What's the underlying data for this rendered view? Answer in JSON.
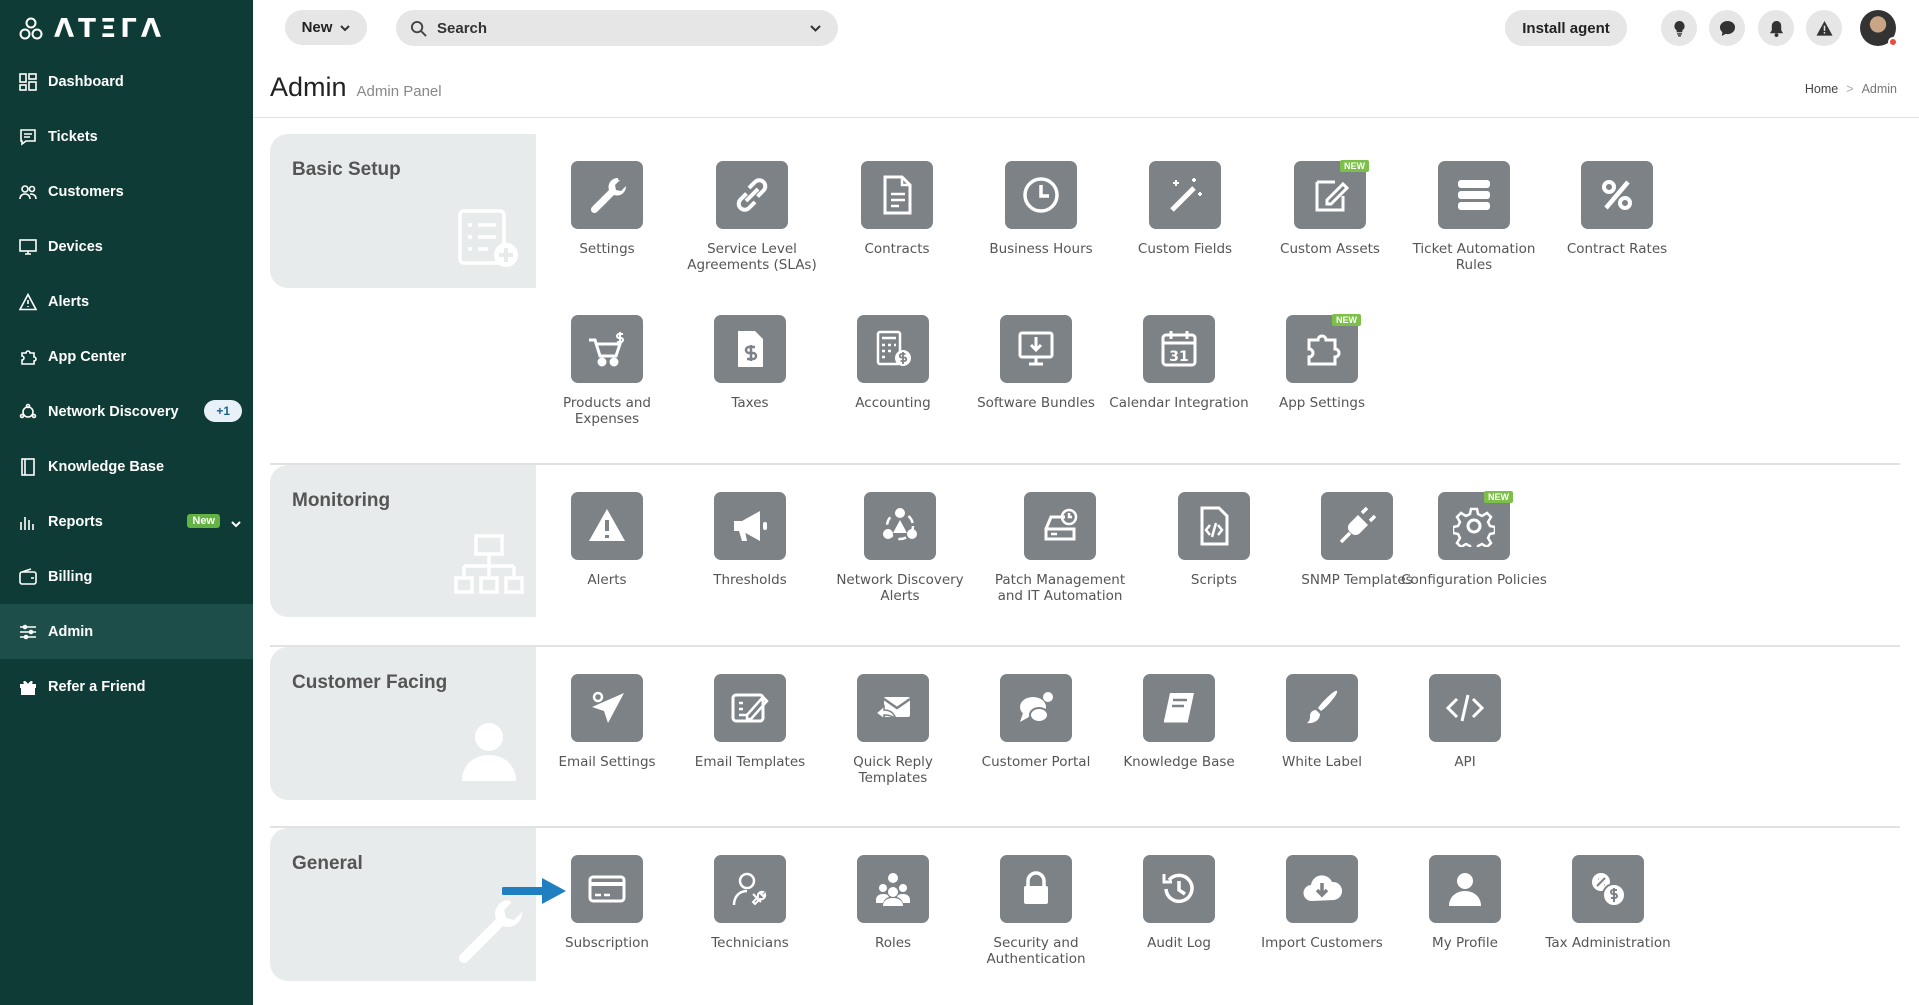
{
  "app": {
    "logo_text": "ΛTΞΓΛ"
  },
  "sidebar": {
    "items": [
      {
        "label": "Dashboard",
        "icon": "grid-icon"
      },
      {
        "label": "Tickets",
        "icon": "ticket-icon"
      },
      {
        "label": "Customers",
        "icon": "users-icon"
      },
      {
        "label": "Devices",
        "icon": "monitor-icon"
      },
      {
        "label": "Alerts",
        "icon": "warning-icon"
      },
      {
        "label": "App Center",
        "icon": "puzzle-icon"
      },
      {
        "label": "Network Discovery",
        "icon": "network-icon",
        "badge": "+1"
      },
      {
        "label": "Knowledge Base",
        "icon": "book-icon"
      },
      {
        "label": "Reports",
        "icon": "chart-icon",
        "badge": "New"
      },
      {
        "label": "Billing",
        "icon": "wallet-icon"
      },
      {
        "label": "Admin",
        "icon": "sliders-icon",
        "active": true
      },
      {
        "label": "Refer a Friend",
        "icon": "gift-icon"
      }
    ]
  },
  "topbar": {
    "new_label": "New",
    "search_placeholder": "Search",
    "install_agent_label": "Install agent"
  },
  "page": {
    "title": "Admin",
    "subtitle": "Admin Panel",
    "breadcrumb": [
      "Home",
      "Admin"
    ]
  },
  "sections": {
    "basic_setup": {
      "title": "Basic Setup",
      "items": [
        "Settings",
        "Service Level Agreements (SLAs)",
        "Contracts",
        "Business Hours",
        "Custom Fields",
        "Custom Assets",
        "Ticket Automation Rules",
        "Contract Rates",
        "Products and Expenses",
        "Taxes",
        "Accounting",
        "Software Bundles",
        "Calendar Integration",
        "App Settings"
      ]
    },
    "monitoring": {
      "title": "Monitoring",
      "items": [
        "Alerts",
        "Thresholds",
        "Network Discovery Alerts",
        "Patch Management and IT Automation",
        "Scripts",
        "SNMP Templates",
        "Configuration Policies"
      ]
    },
    "customer_facing": {
      "title": "Customer Facing",
      "items": [
        "Email Settings",
        "Email Templates",
        "Quick Reply Templates",
        "Customer Portal",
        "Knowledge Base",
        "White Label",
        "API"
      ]
    },
    "general": {
      "title": "General",
      "items": [
        "Subscription",
        "Technicians",
        "Roles",
        "Security and Authentication",
        "Audit Log",
        "Import Customers",
        "My Profile",
        "Tax Administration"
      ]
    }
  },
  "new_badge": "NEW",
  "calendar_day": "31",
  "colors": {
    "sidebar_bg": "#0f3b37",
    "tile_bg": "#7d8287",
    "new_badge": "#7cc04a",
    "arrow": "#1f7fc1"
  }
}
